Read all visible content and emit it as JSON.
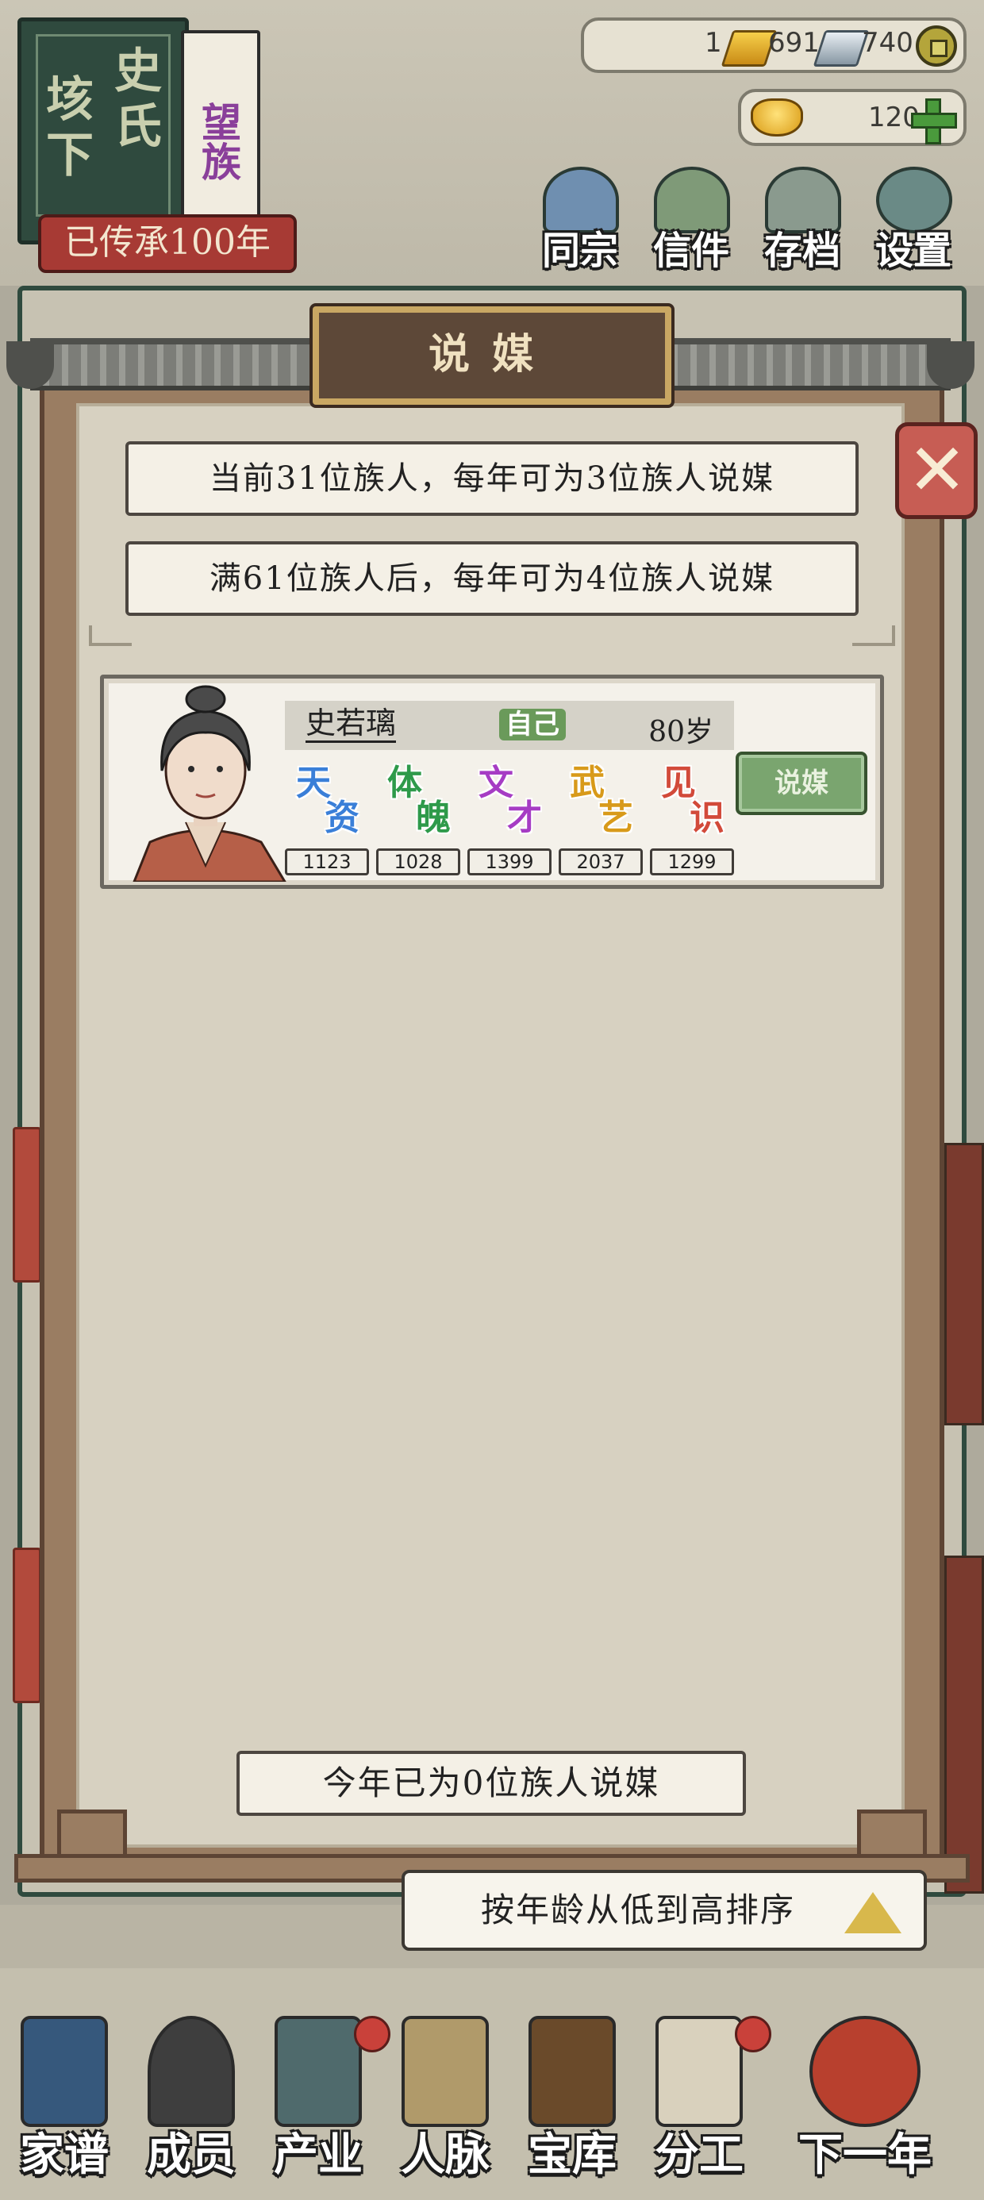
{
  "hud": {
    "clan_chars": [
      "垓",
      "下",
      "史",
      "氏"
    ],
    "clan_rank": "望族",
    "inherit_text": "已传承100年",
    "resources": {
      "gold_count": "1",
      "gold_bars": "691",
      "silver_bars": "740"
    },
    "ingot_count": "120"
  },
  "top_menu": [
    {
      "label": "同宗"
    },
    {
      "label": "信件"
    },
    {
      "label": "存档"
    },
    {
      "label": "设置"
    }
  ],
  "modal": {
    "title": "说媒",
    "info_current": "当前31位族人，每年可为3位族人说媒",
    "info_next": "满61位族人后，每年可为4位族人说媒",
    "count_text": "今年已为0位族人说媒",
    "sort_label": "按年龄从低到高排序"
  },
  "member": {
    "name": "史若璃",
    "badge": "自己",
    "age": "80岁",
    "button": "说媒",
    "stats": [
      {
        "c1": "天",
        "c2": "资",
        "value": "1123",
        "color": "#3a7fd8"
      },
      {
        "c1": "体",
        "c2": "魄",
        "value": "1028",
        "color": "#2e9a4a"
      },
      {
        "c1": "文",
        "c2": "才",
        "value": "1399",
        "color": "#a63cc4"
      },
      {
        "c1": "武",
        "c2": "艺",
        "value": "2037",
        "color": "#d89a1a"
      },
      {
        "c1": "见",
        "c2": "识",
        "value": "1299",
        "color": "#d24a3a"
      }
    ]
  },
  "bottom_nav": [
    {
      "label": "家谱"
    },
    {
      "label": "成员"
    },
    {
      "label": "产业"
    },
    {
      "label": "人脉"
    },
    {
      "label": "宝库"
    },
    {
      "label": "分工"
    },
    {
      "label": "下一年"
    }
  ],
  "colors": {
    "accent_green": "#7aa56f",
    "panel_wood": "#9a7d62",
    "title_gold": "#c9a763"
  }
}
